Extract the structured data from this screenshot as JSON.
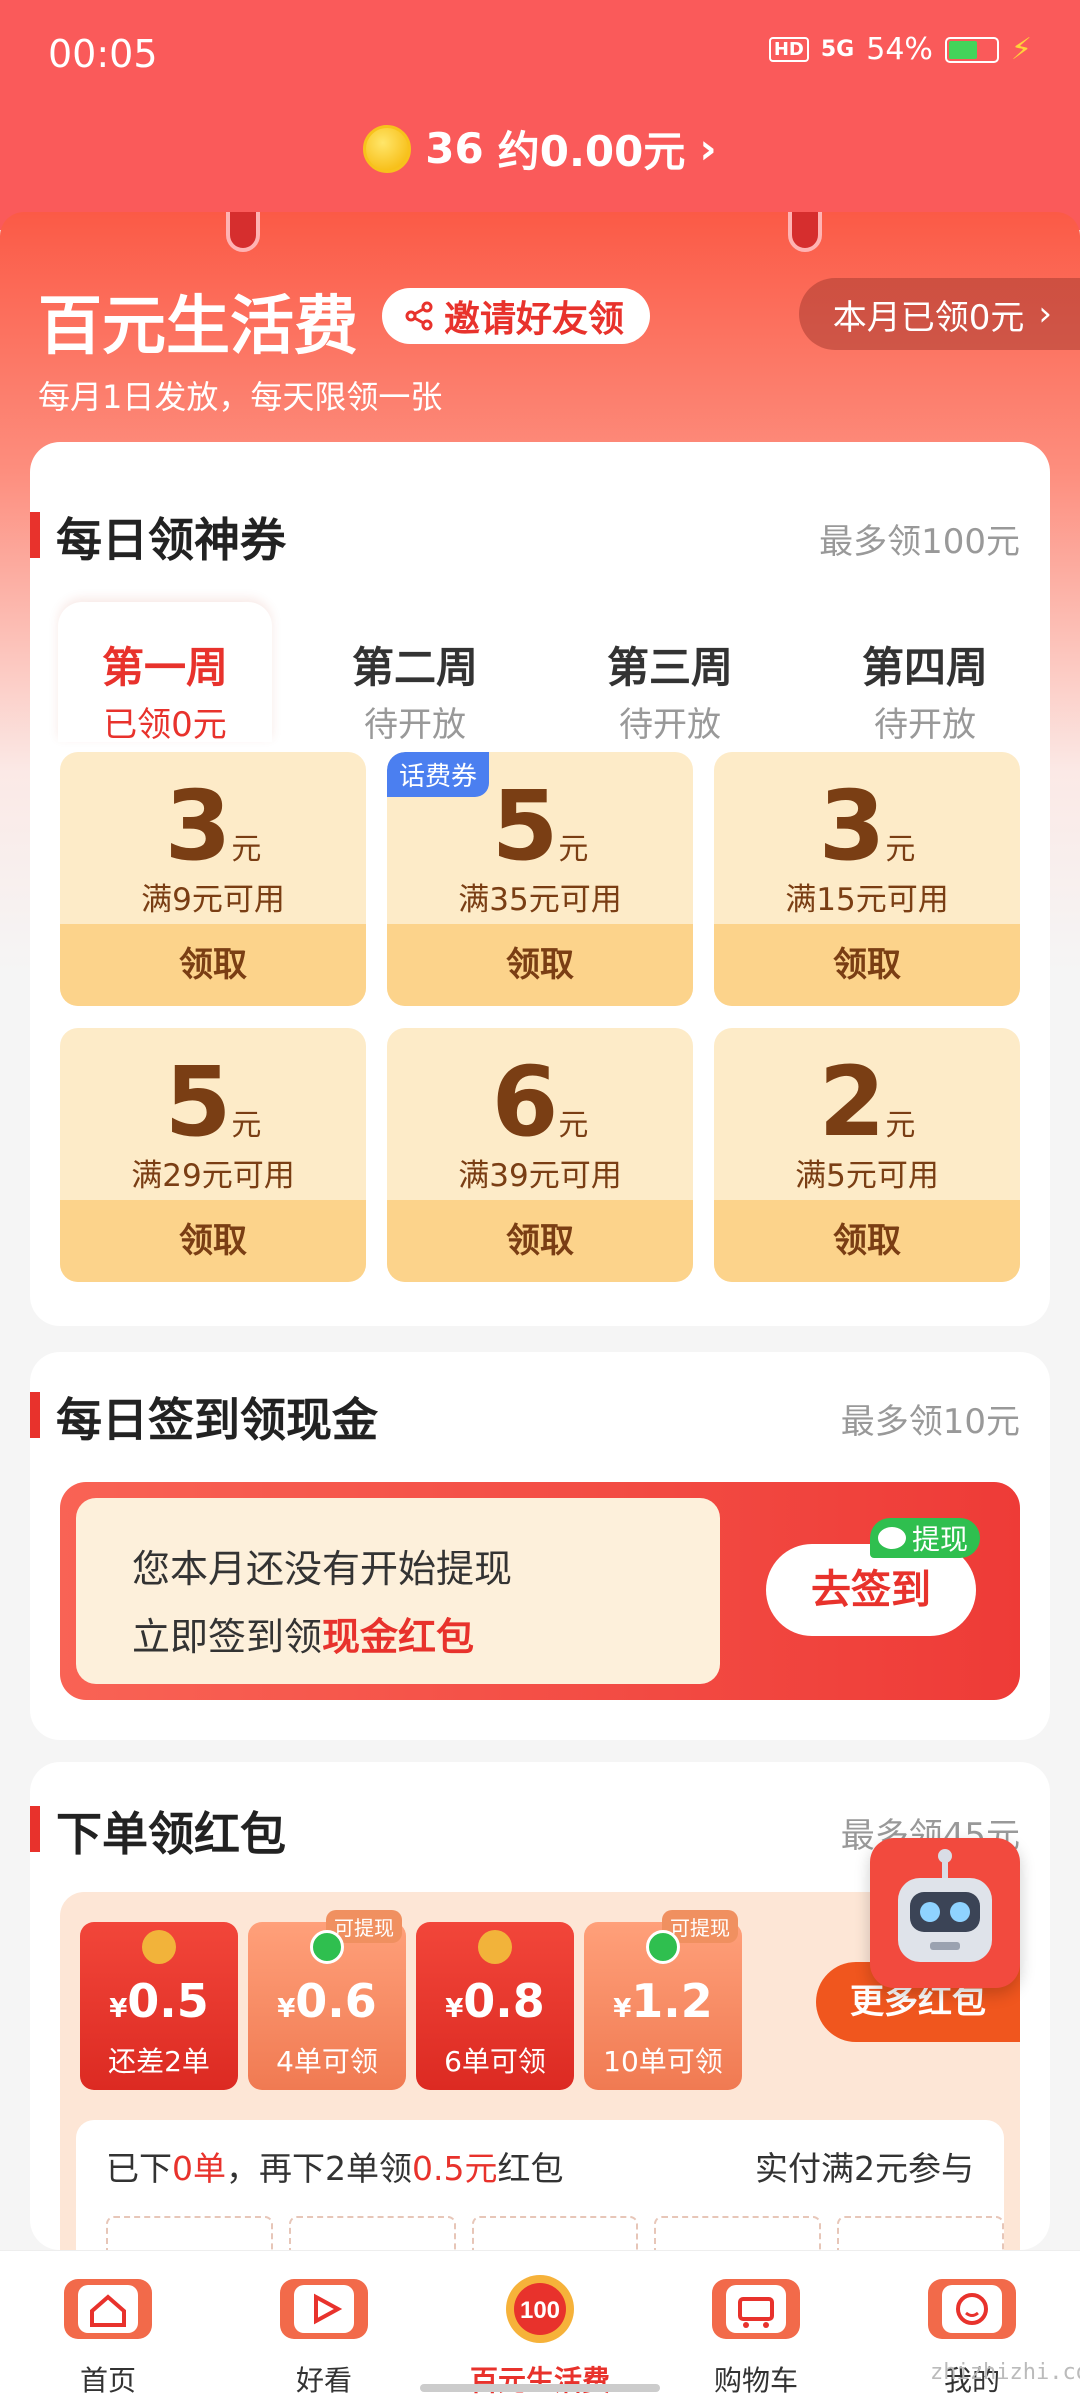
{
  "status_bar": {
    "time": "00:05",
    "hd": "HD",
    "network": "5G",
    "battery": "54%"
  },
  "header": {
    "coin_count": "36",
    "coin_value": "约0.00元"
  },
  "hero": {
    "title": "百元生活费",
    "invite_label": "邀请好友领",
    "month_claimed": "本月已领0元",
    "subtitle": "每月1日发放，每天限领一张"
  },
  "daily_coupons": {
    "title": "每日领神券",
    "note": "最多领100元",
    "weeks": [
      {
        "name": "第一周",
        "status": "已领0元"
      },
      {
        "name": "第二周",
        "status": "待开放"
      },
      {
        "name": "第三周",
        "status": "待开放"
      },
      {
        "name": "第四周",
        "status": "待开放"
      }
    ],
    "coupons": [
      {
        "amount": "3",
        "unit": "元",
        "condition": "满9元可用",
        "button": "领取",
        "tag": ""
      },
      {
        "amount": "5",
        "unit": "元",
        "condition": "满35元可用",
        "button": "领取",
        "tag": "话费券"
      },
      {
        "amount": "3",
        "unit": "元",
        "condition": "满15元可用",
        "button": "领取",
        "tag": ""
      },
      {
        "amount": "5",
        "unit": "元",
        "condition": "满29元可用",
        "button": "领取",
        "tag": ""
      },
      {
        "amount": "6",
        "unit": "元",
        "condition": "满39元可用",
        "button": "领取",
        "tag": ""
      },
      {
        "amount": "2",
        "unit": "元",
        "condition": "满5元可用",
        "button": "领取",
        "tag": ""
      }
    ]
  },
  "checkin": {
    "title": "每日签到领现金",
    "note": "最多领10元",
    "line1": "您本月还没有开始提现",
    "line2_prefix": "立即签到领",
    "line2_highlight": "现金红包",
    "button": "去签到",
    "withdraw_tag": "提现"
  },
  "order_packets": {
    "title": "下单领红包",
    "note": "最多领45元",
    "packets": [
      {
        "yen": "¥",
        "amount": "0.5",
        "note": "还差2单",
        "style": "red",
        "tag": ""
      },
      {
        "yen": "¥",
        "amount": "0.6",
        "note": "4单可领",
        "style": "orange",
        "tag": "可提现"
      },
      {
        "yen": "¥",
        "amount": "0.8",
        "note": "6单可领",
        "style": "red",
        "tag": ""
      },
      {
        "yen": "¥",
        "amount": "1.2",
        "note": "10单可领",
        "style": "orange",
        "tag": "可提现"
      }
    ],
    "more_button": "更多红包",
    "progress_prefix": "已下",
    "progress_count": "0单",
    "progress_mid": "，再下2单领",
    "progress_amount": "0.5元",
    "progress_suffix": "红包",
    "requirement": "实付满2元参与"
  },
  "bottom_nav": [
    {
      "label": "首页",
      "icon": "home-icon"
    },
    {
      "label": "好看",
      "icon": "play-icon"
    },
    {
      "label": "百元生活费",
      "icon": "badge-100-icon",
      "badge": "100"
    },
    {
      "label": "购物车",
      "icon": "cart-icon"
    },
    {
      "label": "我的",
      "icon": "profile-icon"
    }
  ],
  "watermark": "zhizhizhi.com",
  "colors": {
    "brand_red": "#e8322c",
    "header_red": "#fa5a5a",
    "coupon_bg": "#fdebc8",
    "coupon_button": "#fcd38b",
    "coupon_text": "#7a3e14"
  }
}
